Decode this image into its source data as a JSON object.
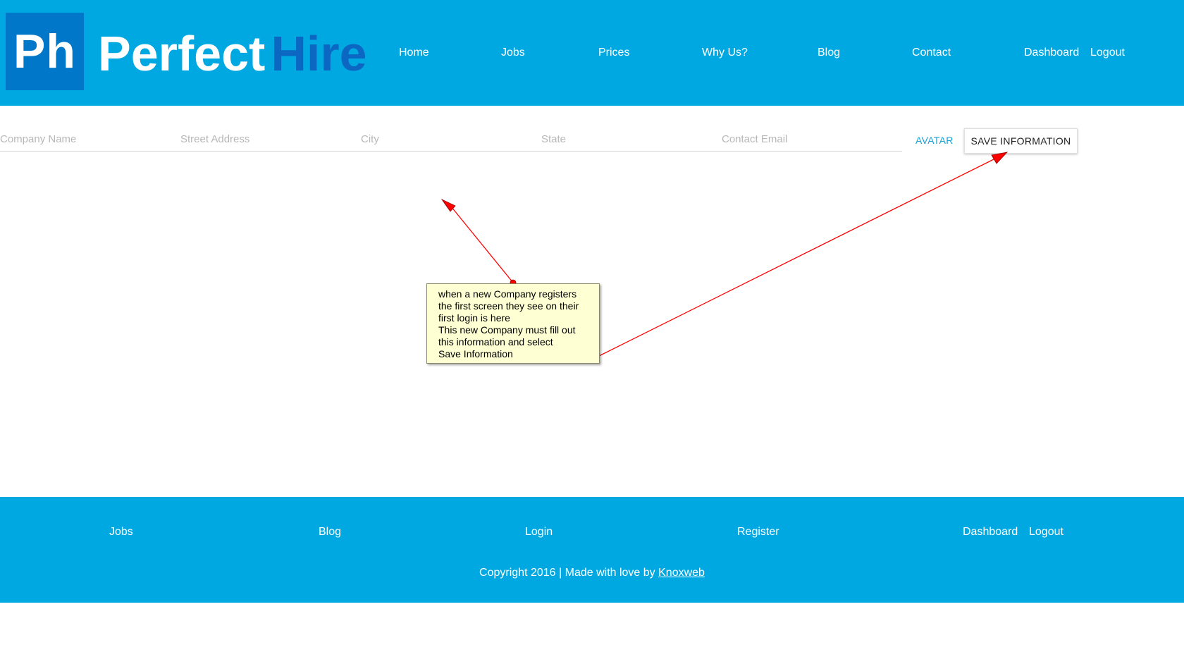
{
  "brand": {
    "mark": "Ph",
    "name_part1": "Perfect",
    "name_part2": "Hire"
  },
  "nav": {
    "home": "Home",
    "jobs": "Jobs",
    "prices": "Prices",
    "why_us": "Why Us?",
    "blog": "Blog",
    "contact": "Contact",
    "dashboard": "Dashboard",
    "logout": "Logout"
  },
  "form": {
    "company_name": {
      "placeholder": "Company Name",
      "value": ""
    },
    "street_address": {
      "placeholder": "Street Address",
      "value": ""
    },
    "city": {
      "placeholder": "City",
      "value": ""
    },
    "state": {
      "placeholder": "State",
      "value": ""
    },
    "contact_email": {
      "placeholder": "Contact Email",
      "value": ""
    },
    "avatar_label": "AVATAR",
    "save_label": "SAVE INFORMATION"
  },
  "annotation": {
    "lines": [
      "when a new Company registers",
      "the first screen they see on their",
      "first login is here",
      "This new Company must fill out",
      "this information and select",
      "Save Information"
    ],
    "color": "#ff0000"
  },
  "footer": {
    "links": {
      "jobs": "Jobs",
      "blog": "Blog",
      "login": "Login",
      "register": "Register",
      "dashboard": "Dashboard",
      "logout": "Logout"
    },
    "copyright_text": "Copyright 2016 | Made with love by",
    "credit_link": "Knoxweb"
  },
  "colors": {
    "header_bg": "#00a8e1",
    "logo_box": "#0077c8",
    "logo_hire": "#0b67c2",
    "accent_link": "#1aa0d6",
    "note_bg": "#ffffd4"
  }
}
